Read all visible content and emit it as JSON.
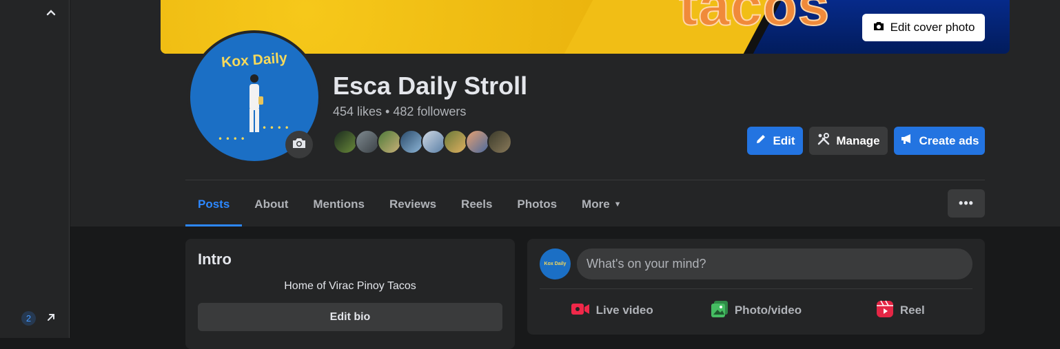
{
  "left_rail": {
    "badge_count": "2"
  },
  "cover": {
    "visible_word": "tacos",
    "edit_cover_label": "Edit cover photo"
  },
  "avatar": {
    "logo_text": "Kox Daily"
  },
  "page": {
    "name": "Esca Daily Stroll",
    "stats": "454 likes • 482 followers"
  },
  "actions": {
    "edit_label": "Edit",
    "manage_label": "Manage",
    "create_ads_label": "Create ads"
  },
  "tabs": [
    {
      "label": "Posts",
      "active": true
    },
    {
      "label": "About"
    },
    {
      "label": "Mentions"
    },
    {
      "label": "Reviews"
    },
    {
      "label": "Reels"
    },
    {
      "label": "Photos"
    },
    {
      "label": "More"
    }
  ],
  "intro": {
    "title": "Intro",
    "bio": "Home of Virac Pinoy Tacos",
    "edit_bio_label": "Edit bio"
  },
  "composer": {
    "avatar_text": "Kox Daily",
    "placeholder": "What's on your mind?",
    "live_label": "Live video",
    "photo_label": "Photo/video",
    "reel_label": "Reel"
  },
  "colors": {
    "accent": "#2374e1",
    "tab_active": "#2d88ff",
    "live": "#f02849",
    "photo": "#45bd62",
    "reel": "#e42645"
  }
}
